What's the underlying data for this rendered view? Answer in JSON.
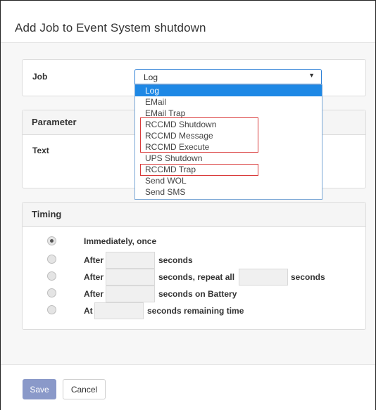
{
  "dialog": {
    "title": "Add Job to Event System shutdown"
  },
  "job": {
    "label": "Job",
    "selected": "Log",
    "options": [
      "Log",
      "EMail",
      "EMail Trap",
      "RCCMD Shutdown",
      "RCCMD Message",
      "RCCMD Execute",
      "UPS Shutdown",
      "RCCMD Trap",
      "Send WOL",
      "Send SMS"
    ],
    "selected_index": 0
  },
  "parameter": {
    "header": "Parameter",
    "text_label": "Text"
  },
  "timing": {
    "header": "Timing",
    "immediately": "Immediately, once",
    "after": "After",
    "seconds": "seconds",
    "repeat_all": "seconds, repeat all",
    "seconds_on_battery": "seconds on Battery",
    "at": "At",
    "seconds_remaining": "seconds remaining time",
    "selected_option": "immediately"
  },
  "footer": {
    "save": "Save",
    "cancel": "Cancel"
  },
  "colors": {
    "selected_bg": "#1e88e5",
    "highlight_border": "#d93a3a",
    "save_bg": "#8a99c9"
  }
}
